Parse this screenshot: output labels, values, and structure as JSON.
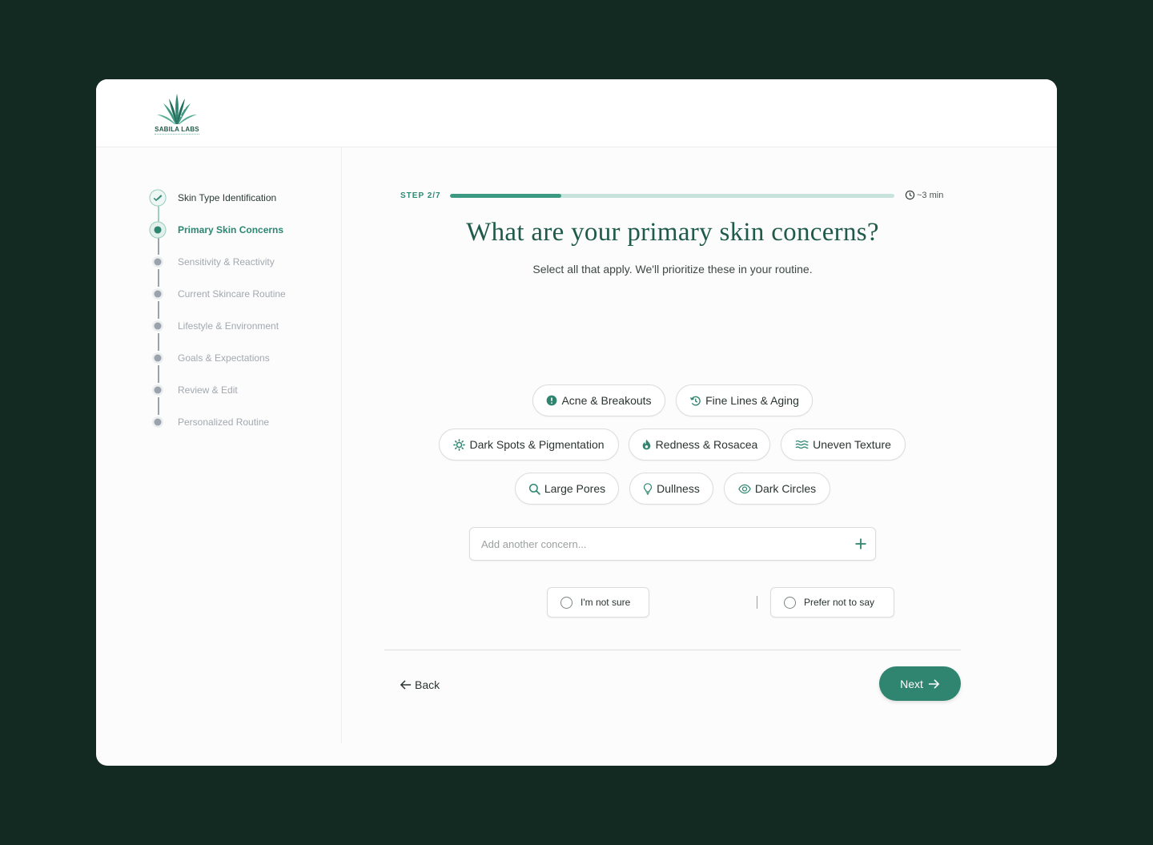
{
  "brand": {
    "name": "SABILA LABS",
    "accent": "#2f8570"
  },
  "sidebar": {
    "steps": [
      {
        "label": "Skin Type Identification",
        "state": "done"
      },
      {
        "label": "Primary Skin Concerns",
        "state": "active"
      },
      {
        "label": "Sensitivity & Reactivity",
        "state": "pending"
      },
      {
        "label": "Current Skincare Routine",
        "state": "pending"
      },
      {
        "label": "Lifestyle & Environment",
        "state": "pending"
      },
      {
        "label": "Goals & Expectations",
        "state": "pending"
      },
      {
        "label": "Review & Edit",
        "state": "pending"
      },
      {
        "label": "Personalized Routine",
        "state": "pending"
      }
    ]
  },
  "progress": {
    "step_label": "STEP 2/7",
    "fraction": 0.25,
    "time": "~3 min"
  },
  "question": {
    "title": "What are your primary skin concerns?",
    "subtitle": "Select all that apply. We'll prioritize these in your routine."
  },
  "concerns": [
    {
      "label": "Acne & Breakouts",
      "icon": "alert-circle-icon"
    },
    {
      "label": "Fine Lines & Aging",
      "icon": "history-icon"
    },
    {
      "label": "Dark Spots & Pigmentation",
      "icon": "sun-icon"
    },
    {
      "label": "Redness & Rosacea",
      "icon": "flame-icon"
    },
    {
      "label": "Uneven Texture",
      "icon": "waves-icon"
    },
    {
      "label": "Large Pores",
      "icon": "search-icon"
    },
    {
      "label": "Dullness",
      "icon": "lightbulb-icon"
    },
    {
      "label": "Dark Circles",
      "icon": "eye-icon"
    }
  ],
  "add_concern": {
    "placeholder": "Add another concern..."
  },
  "options": [
    {
      "label": "I'm not sure"
    },
    {
      "label": "Prefer not to say"
    }
  ],
  "nav": {
    "back_label": "Back",
    "next_label": "Next"
  }
}
